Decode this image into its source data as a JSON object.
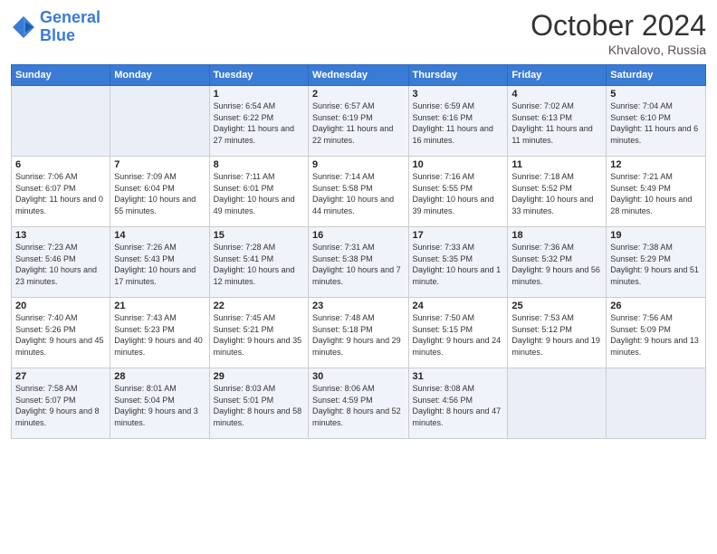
{
  "logo": {
    "text_general": "General",
    "text_blue": "Blue"
  },
  "header": {
    "month": "October 2024",
    "location": "Khvalovo, Russia"
  },
  "weekdays": [
    "Sunday",
    "Monday",
    "Tuesday",
    "Wednesday",
    "Thursday",
    "Friday",
    "Saturday"
  ],
  "weeks": [
    [
      {
        "day": "",
        "detail": ""
      },
      {
        "day": "",
        "detail": ""
      },
      {
        "day": "1",
        "detail": "Sunrise: 6:54 AM\nSunset: 6:22 PM\nDaylight: 11 hours and 27 minutes."
      },
      {
        "day": "2",
        "detail": "Sunrise: 6:57 AM\nSunset: 6:19 PM\nDaylight: 11 hours and 22 minutes."
      },
      {
        "day": "3",
        "detail": "Sunrise: 6:59 AM\nSunset: 6:16 PM\nDaylight: 11 hours and 16 minutes."
      },
      {
        "day": "4",
        "detail": "Sunrise: 7:02 AM\nSunset: 6:13 PM\nDaylight: 11 hours and 11 minutes."
      },
      {
        "day": "5",
        "detail": "Sunrise: 7:04 AM\nSunset: 6:10 PM\nDaylight: 11 hours and 6 minutes."
      }
    ],
    [
      {
        "day": "6",
        "detail": "Sunrise: 7:06 AM\nSunset: 6:07 PM\nDaylight: 11 hours and 0 minutes."
      },
      {
        "day": "7",
        "detail": "Sunrise: 7:09 AM\nSunset: 6:04 PM\nDaylight: 10 hours and 55 minutes."
      },
      {
        "day": "8",
        "detail": "Sunrise: 7:11 AM\nSunset: 6:01 PM\nDaylight: 10 hours and 49 minutes."
      },
      {
        "day": "9",
        "detail": "Sunrise: 7:14 AM\nSunset: 5:58 PM\nDaylight: 10 hours and 44 minutes."
      },
      {
        "day": "10",
        "detail": "Sunrise: 7:16 AM\nSunset: 5:55 PM\nDaylight: 10 hours and 39 minutes."
      },
      {
        "day": "11",
        "detail": "Sunrise: 7:18 AM\nSunset: 5:52 PM\nDaylight: 10 hours and 33 minutes."
      },
      {
        "day": "12",
        "detail": "Sunrise: 7:21 AM\nSunset: 5:49 PM\nDaylight: 10 hours and 28 minutes."
      }
    ],
    [
      {
        "day": "13",
        "detail": "Sunrise: 7:23 AM\nSunset: 5:46 PM\nDaylight: 10 hours and 23 minutes."
      },
      {
        "day": "14",
        "detail": "Sunrise: 7:26 AM\nSunset: 5:43 PM\nDaylight: 10 hours and 17 minutes."
      },
      {
        "day": "15",
        "detail": "Sunrise: 7:28 AM\nSunset: 5:41 PM\nDaylight: 10 hours and 12 minutes."
      },
      {
        "day": "16",
        "detail": "Sunrise: 7:31 AM\nSunset: 5:38 PM\nDaylight: 10 hours and 7 minutes."
      },
      {
        "day": "17",
        "detail": "Sunrise: 7:33 AM\nSunset: 5:35 PM\nDaylight: 10 hours and 1 minute."
      },
      {
        "day": "18",
        "detail": "Sunrise: 7:36 AM\nSunset: 5:32 PM\nDaylight: 9 hours and 56 minutes."
      },
      {
        "day": "19",
        "detail": "Sunrise: 7:38 AM\nSunset: 5:29 PM\nDaylight: 9 hours and 51 minutes."
      }
    ],
    [
      {
        "day": "20",
        "detail": "Sunrise: 7:40 AM\nSunset: 5:26 PM\nDaylight: 9 hours and 45 minutes."
      },
      {
        "day": "21",
        "detail": "Sunrise: 7:43 AM\nSunset: 5:23 PM\nDaylight: 9 hours and 40 minutes."
      },
      {
        "day": "22",
        "detail": "Sunrise: 7:45 AM\nSunset: 5:21 PM\nDaylight: 9 hours and 35 minutes."
      },
      {
        "day": "23",
        "detail": "Sunrise: 7:48 AM\nSunset: 5:18 PM\nDaylight: 9 hours and 29 minutes."
      },
      {
        "day": "24",
        "detail": "Sunrise: 7:50 AM\nSunset: 5:15 PM\nDaylight: 9 hours and 24 minutes."
      },
      {
        "day": "25",
        "detail": "Sunrise: 7:53 AM\nSunset: 5:12 PM\nDaylight: 9 hours and 19 minutes."
      },
      {
        "day": "26",
        "detail": "Sunrise: 7:56 AM\nSunset: 5:09 PM\nDaylight: 9 hours and 13 minutes."
      }
    ],
    [
      {
        "day": "27",
        "detail": "Sunrise: 7:58 AM\nSunset: 5:07 PM\nDaylight: 9 hours and 8 minutes."
      },
      {
        "day": "28",
        "detail": "Sunrise: 8:01 AM\nSunset: 5:04 PM\nDaylight: 9 hours and 3 minutes."
      },
      {
        "day": "29",
        "detail": "Sunrise: 8:03 AM\nSunset: 5:01 PM\nDaylight: 8 hours and 58 minutes."
      },
      {
        "day": "30",
        "detail": "Sunrise: 8:06 AM\nSunset: 4:59 PM\nDaylight: 8 hours and 52 minutes."
      },
      {
        "day": "31",
        "detail": "Sunrise: 8:08 AM\nSunset: 4:56 PM\nDaylight: 8 hours and 47 minutes."
      },
      {
        "day": "",
        "detail": ""
      },
      {
        "day": "",
        "detail": ""
      }
    ]
  ]
}
